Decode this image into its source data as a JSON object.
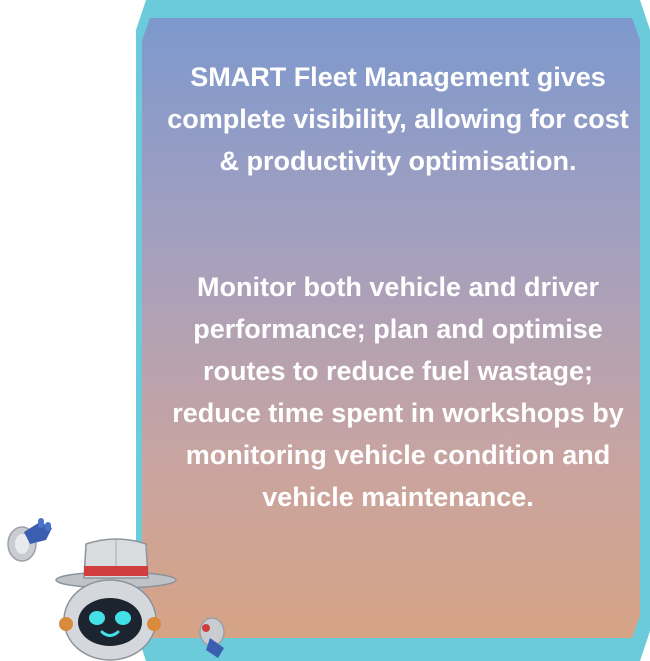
{
  "content": {
    "intro": "SMART Fleet Management gives complete visibility, allowing for cost & productivity optimisation.",
    "detail": "Monitor both vehicle and driver performance; plan and optimise routes to reduce fuel wastage; reduce time spent in workshops by monitoring vehicle condition and vehicle maintenance."
  },
  "colors": {
    "frame": "#6ccbdb",
    "gradient_top": "#7d99ce",
    "gradient_bottom": "#d6a385",
    "text": "#ffffff"
  },
  "icons": [
    "robot-mascot-icon",
    "robot-hand-left-icon",
    "robot-hand-right-icon"
  ]
}
